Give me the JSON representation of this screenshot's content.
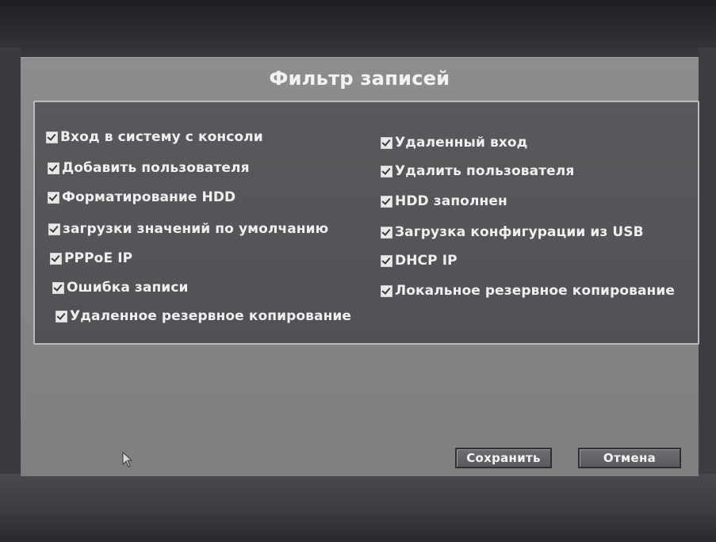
{
  "dialog": {
    "title": "Фильтр записей",
    "items": [
      {
        "label": "Вход в систему с консоли",
        "checked": true
      },
      {
        "label": "Удаленный вход",
        "checked": true
      },
      {
        "label": "Добавить пользователя",
        "checked": true
      },
      {
        "label": "Удалить пользователя",
        "checked": true
      },
      {
        "label": "Форматирование HDD",
        "checked": true
      },
      {
        "label": "HDD заполнен",
        "checked": true
      },
      {
        "label": "загрузки значений по умолчанию",
        "checked": true
      },
      {
        "label": "Загрузка конфигурации из USB",
        "checked": true
      },
      {
        "label": "PPPoE IP",
        "checked": true
      },
      {
        "label": "DHCP IP",
        "checked": true
      },
      {
        "label": "Ошибка записи",
        "checked": true
      },
      {
        "label": "Локальное резервное копирование",
        "checked": true
      },
      {
        "label": "Удаленное резервное копирование",
        "checked": true
      }
    ],
    "buttons": {
      "save": "Сохранить",
      "cancel": "Отмена"
    }
  },
  "icons": {
    "checkbox": "checkmark-icon",
    "cursor": "mouse-pointer-icon"
  }
}
